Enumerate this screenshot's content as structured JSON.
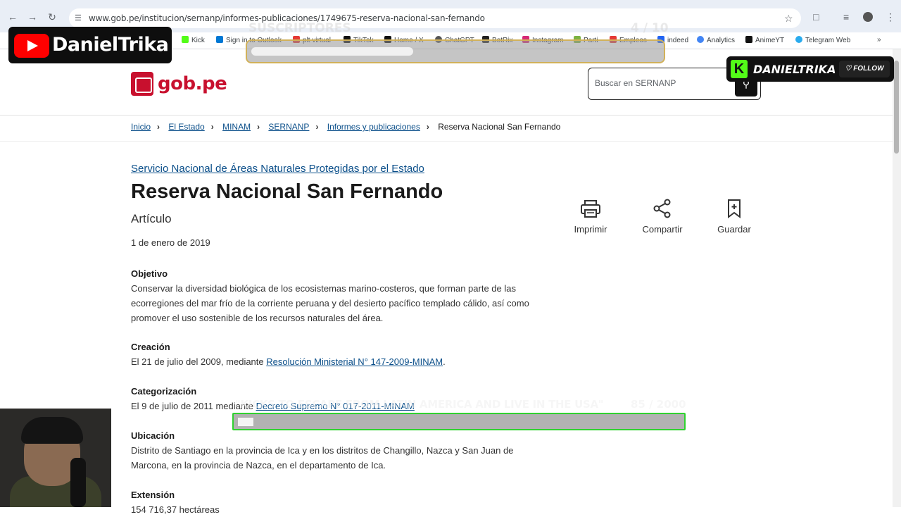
{
  "browser": {
    "url": "www.gob.pe/institucion/sernanp/informes-publicaciones/1749675-reserva-nacional-san-fernando",
    "bookmarks": [
      "Kick",
      "Sign in to Outlook",
      "plt virtual",
      "TikTok",
      "Home / X",
      "ChatGPT",
      "BotRix",
      "Instagram",
      "Parti",
      "Empleos",
      "indeed",
      "Analytics",
      "AnimeYT",
      "Telegram Web"
    ]
  },
  "overlay": {
    "youtube_name": "DanielTrika",
    "subs_label": "SUSCRIPTORES",
    "subs_count": "4  / 10",
    "kick_name": "DANIELTRIKA",
    "follow_label": "FOLLOW",
    "goal_label": "\"KICKS TO ESCAPE FROM LATIN AMERICA AND LIVE IN THE USA\"",
    "goal_count": "85  / 2000"
  },
  "site": {
    "logo_text": "gob.pe",
    "search_placeholder": "Buscar en SERNANP"
  },
  "breadcrumb": [
    "Inicio",
    "El Estado",
    "MINAM",
    "SERNANP",
    "Informes y publicaciones",
    "Reserva Nacional San Fernando"
  ],
  "article": {
    "institution": "Servicio Nacional de Áreas Naturales Protegidas por el Estado",
    "title": "Reserva Nacional San Fernando",
    "type": "Artículo",
    "date": "1 de enero de 2019",
    "sections": {
      "objetivo": {
        "heading": "Objetivo",
        "text": "Conservar la diversidad biológica de los ecosistemas marino-costeros, que forman parte de las ecorregiones del mar frío de la corriente peruana y del desierto pacífico templado cálido, así como promover el uso sostenible de los recursos naturales del área."
      },
      "creacion": {
        "heading": "Creación",
        "text_before": "El 21 de julio del 2009, mediante ",
        "link": "Resolución Ministerial N° 147-2009-MINAM",
        "text_after": "."
      },
      "categorizacion": {
        "heading": "Categorización",
        "text_before": "El 9 de julio de 2011 mediante ",
        "link": "Decreto Supremo N° 017-2011-MINAM"
      },
      "ubicacion": {
        "heading": "Ubicación",
        "text": "Distrito de Santiago en la provincia de Ica y en los distritos de Changillo, Nazca y San Juan de Marcona, en la provincia de Nazca, en el departamento de Ica."
      },
      "extension": {
        "heading": "Extensión",
        "text": "154 716,37 hectáreas"
      }
    }
  },
  "actions": {
    "print": "Imprimir",
    "share": "Compartir",
    "save": "Guardar"
  }
}
